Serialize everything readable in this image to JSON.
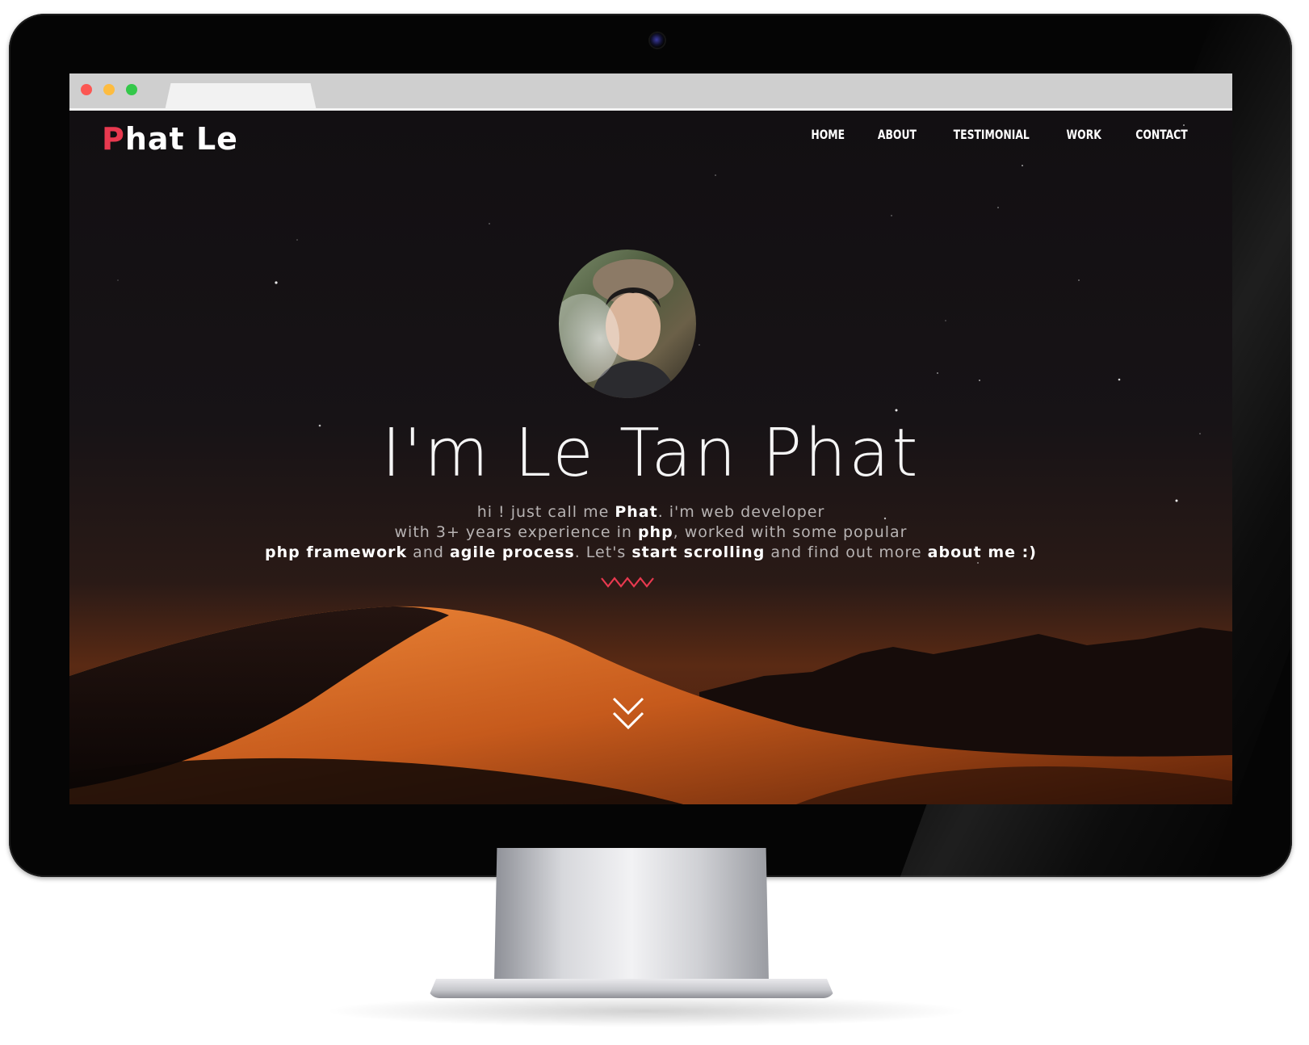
{
  "site": {
    "logo": {
      "first": "P",
      "rest": "hat Le"
    },
    "nav": [
      {
        "label": "HOME"
      },
      {
        "label": "ABOUT"
      },
      {
        "label": "TESTIMONIAL"
      },
      {
        "label": "WORK"
      },
      {
        "label": "CONTACT"
      }
    ],
    "hero": {
      "title": "I'm Le Tan Phat",
      "intro": {
        "line1_a": "hi ! just call me ",
        "line1_b": "Phat",
        "line1_c": ". i'm web developer",
        "line2_a": "with 3+ years experience in ",
        "line2_b": "php",
        "line2_c": ", worked with some popular",
        "line3_a": "php framework",
        "line3_b": " and ",
        "line3_c": "agile process",
        "line3_d": ". Let's ",
        "line3_e": "start scrolling",
        "line3_f": " and find out more ",
        "line3_g": "about me :)"
      }
    }
  },
  "colors": {
    "accent": "#e8394f",
    "text": "#ffffff",
    "muted_text": "#b7b3b3"
  },
  "icons": {
    "decor": "zigzag-icon",
    "scroll": "double-chevron-down-icon"
  }
}
